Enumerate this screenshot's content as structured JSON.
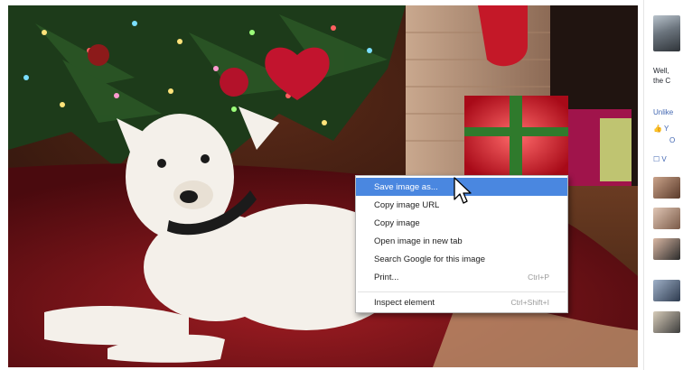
{
  "context_menu": {
    "items": [
      {
        "label": "Save image as...",
        "shortcut": "",
        "highlighted": true
      },
      {
        "label": "Copy image URL",
        "shortcut": ""
      },
      {
        "label": "Copy image",
        "shortcut": ""
      },
      {
        "label": "Open image in new tab",
        "shortcut": ""
      },
      {
        "label": "Search Google for this image",
        "shortcut": ""
      },
      {
        "label": "Print...",
        "shortcut": "Ctrl+P"
      },
      {
        "label": "Inspect element",
        "shortcut": "Ctrl+Shift+I"
      }
    ],
    "highlight_color": "#4a87e0"
  },
  "side_panel": {
    "post_line1": "Well,",
    "post_line2": "the C",
    "unlike_label": "Unlike",
    "like_row": "Y",
    "like_row2": "O",
    "comment_row": "V",
    "link_color": "#4267b2"
  },
  "photo": {
    "subject": "white dog lying on red blanket under Christmas tree"
  },
  "cursor_icon": "arrow-pointer-icon"
}
